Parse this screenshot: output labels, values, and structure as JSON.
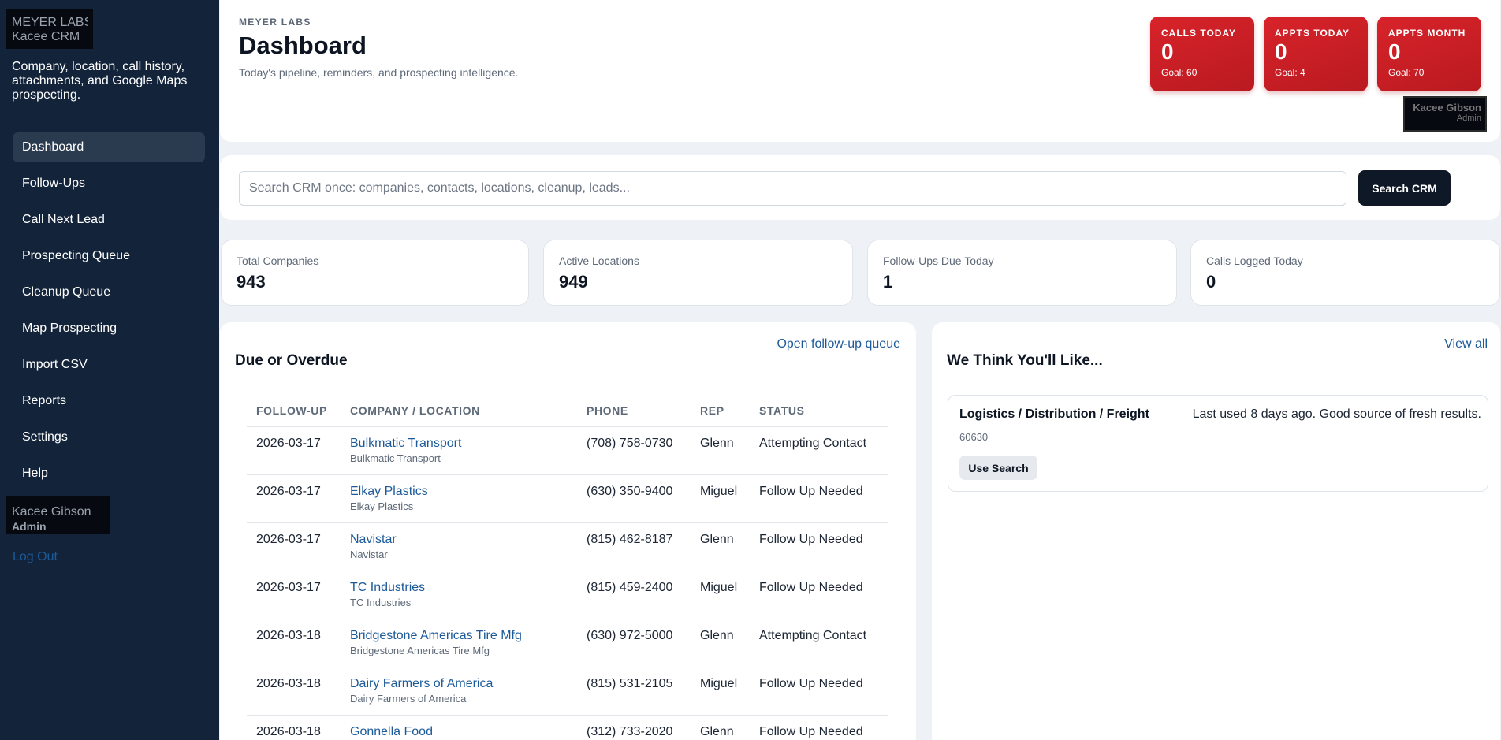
{
  "sidebar": {
    "brand_line1": "MEYER LABS",
    "brand_line2": "Kacee CRM",
    "tagline": "Company, location, call history, attachments, and Google Maps prospecting.",
    "items": [
      {
        "label": "Dashboard",
        "active": true
      },
      {
        "label": "Follow-Ups"
      },
      {
        "label": "Call Next Lead"
      },
      {
        "label": "Prospecting Queue"
      },
      {
        "label": "Cleanup Queue"
      },
      {
        "label": "Map Prospecting"
      },
      {
        "label": "Import CSV"
      },
      {
        "label": "Reports"
      },
      {
        "label": "Settings"
      },
      {
        "label": "Help"
      }
    ],
    "user_name": "Kacee Gibson",
    "user_role": "Admin",
    "logout_label": "Log Out"
  },
  "header": {
    "eyebrow": "MEYER LABS",
    "title": "Dashboard",
    "subtitle": "Today's pipeline, reminders, and prospecting intelligence.",
    "kpis": [
      {
        "label": "CALLS TODAY",
        "value": "0",
        "goal": "Goal: 60"
      },
      {
        "label": "APPTS TODAY",
        "value": "0",
        "goal": "Goal: 4"
      },
      {
        "label": "APPTS MONTH",
        "value": "0",
        "goal": "Goal: 70"
      }
    ],
    "user_name": "Kacee Gibson",
    "user_role": "Admin",
    "accent_color": "#d32027"
  },
  "search": {
    "placeholder": "Search CRM once: companies, contacts, locations, cleanup, leads...",
    "button_label": "Search CRM"
  },
  "stats": [
    {
      "label": "Total Companies",
      "value": "943"
    },
    {
      "label": "Active Locations",
      "value": "949"
    },
    {
      "label": "Follow-Ups Due Today",
      "value": "1"
    },
    {
      "label": "Calls Logged Today",
      "value": "0"
    }
  ],
  "due": {
    "title": "Due or Overdue",
    "link": "Open follow-up queue",
    "columns": [
      "FOLLOW-UP",
      "COMPANY / LOCATION",
      "PHONE",
      "REP",
      "STATUS"
    ],
    "rows": [
      {
        "date": "2026-03-17",
        "company": "Bulkmatic Transport",
        "location": "Bulkmatic Transport",
        "phone": "(708) 758-0730",
        "rep": "Glenn",
        "status": "Attempting Contact"
      },
      {
        "date": "2026-03-17",
        "company": "Elkay Plastics",
        "location": "Elkay Plastics",
        "phone": "(630) 350-9400",
        "rep": "Miguel",
        "status": "Follow Up Needed"
      },
      {
        "date": "2026-03-17",
        "company": "Navistar",
        "location": "Navistar",
        "phone": "(815) 462-8187",
        "rep": "Glenn",
        "status": "Follow Up Needed"
      },
      {
        "date": "2026-03-17",
        "company": "TC Industries",
        "location": "TC Industries",
        "phone": "(815) 459-2400",
        "rep": "Miguel",
        "status": "Follow Up Needed"
      },
      {
        "date": "2026-03-18",
        "company": "Bridgestone Americas Tire Mfg",
        "location": "Bridgestone Americas Tire Mfg",
        "phone": "(630) 972-5000",
        "rep": "Glenn",
        "status": "Attempting Contact"
      },
      {
        "date": "2026-03-18",
        "company": "Dairy Farmers of America",
        "location": "Dairy Farmers of America",
        "phone": "(815) 531-2105",
        "rep": "Miguel",
        "status": "Follow Up Needed"
      },
      {
        "date": "2026-03-18",
        "company": "Gonnella Food",
        "location": "",
        "phone": "(312) 733-2020",
        "rep": "Glenn",
        "status": "Follow Up Needed"
      }
    ]
  },
  "recommend": {
    "title": "We Think You'll Like...",
    "link": "View all",
    "item": {
      "title": "Logistics / Distribution / Freight",
      "note": "Last used 8 days ago. Good source of fresh results.",
      "zip": "60630",
      "button_label": "Use Search"
    }
  }
}
